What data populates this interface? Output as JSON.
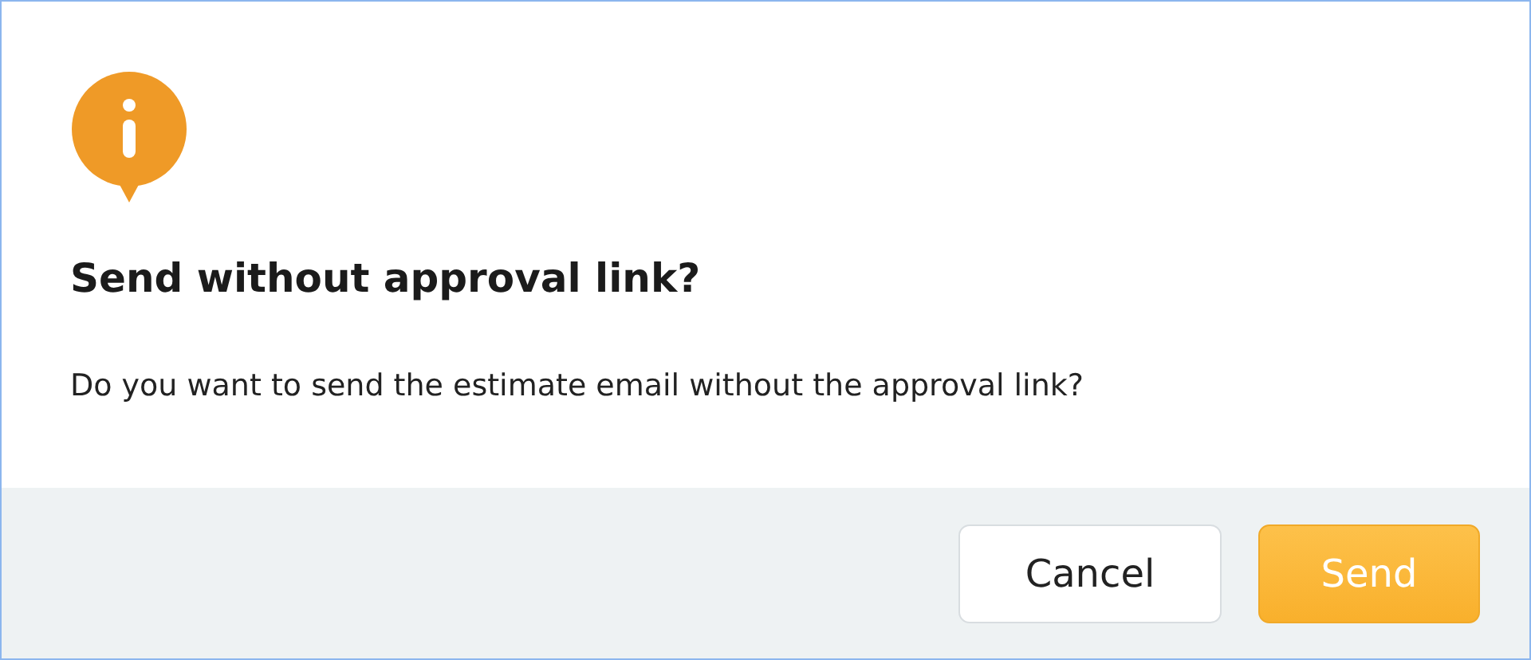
{
  "dialog": {
    "title": "Send without approval link?",
    "message": "Do you want to send the estimate email without the approval link?"
  },
  "buttons": [
    {
      "label": "Cancel",
      "kind": "secondary"
    },
    {
      "label": "Send",
      "kind": "primary"
    }
  ]
}
